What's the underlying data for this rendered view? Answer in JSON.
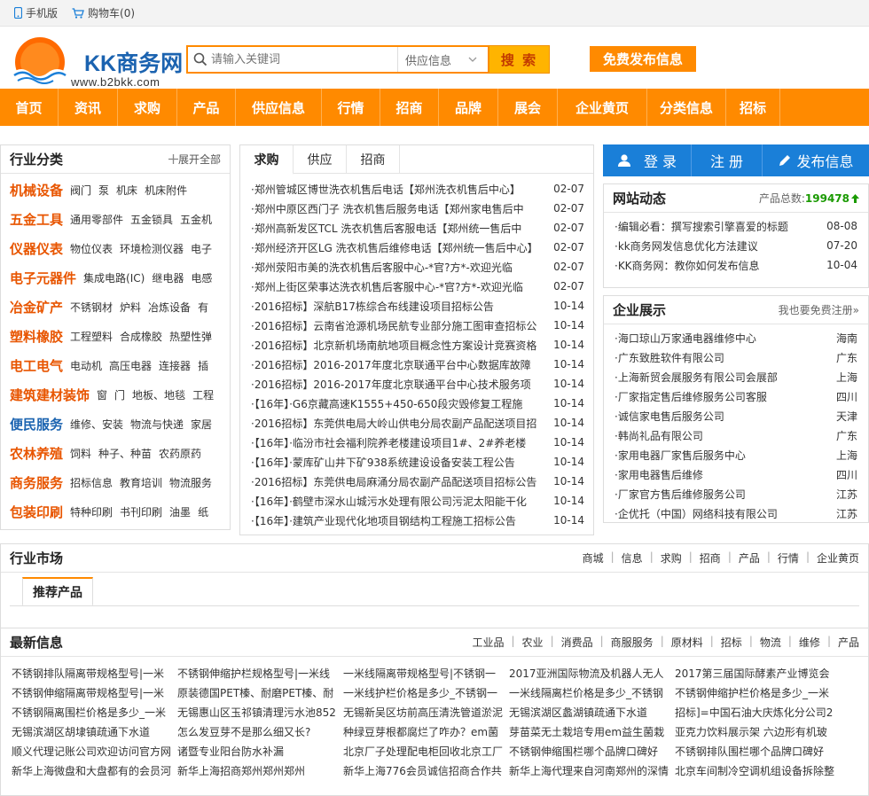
{
  "topbar": {
    "mobile": "手机版",
    "cart": "购物车(0)"
  },
  "logo": {
    "name": "KK商务网",
    "url": "www.b2bkk.com"
  },
  "search": {
    "placeholder": "请输入关键词",
    "scope": "供应信息",
    "button": "搜 索"
  },
  "publish_button": "免费发布信息",
  "nav": [
    "首页",
    "资讯",
    "求购",
    "产品",
    "供应信息",
    "行情",
    "招商",
    "品牌",
    "展会",
    "企业黄页",
    "分类信息",
    "招标"
  ],
  "categories": {
    "title": "行业分类",
    "more": "展开全部",
    "rows": [
      {
        "name": "机械设备",
        "color": "#e85500",
        "subs": [
          "阀门",
          "泵",
          "机床",
          "机床附件"
        ]
      },
      {
        "name": "五金工具",
        "color": "#e85500",
        "subs": [
          "通用零部件",
          "五金锁具",
          "五金机"
        ]
      },
      {
        "name": "仪器仪表",
        "color": "#e85500",
        "subs": [
          "物位仪表",
          "环境检测仪器",
          "电子"
        ]
      },
      {
        "name": "电子元器件",
        "color": "#e85500",
        "subs": [
          "集成电路(IC)",
          "继电器",
          "电感"
        ]
      },
      {
        "name": "冶金矿产",
        "color": "#e85500",
        "subs": [
          "不锈钢材",
          "炉料",
          "冶炼设备",
          "有"
        ]
      },
      {
        "name": "塑料橡胶",
        "color": "#e85500",
        "subs": [
          "工程塑料",
          "合成橡胶",
          "热塑性弹"
        ]
      },
      {
        "name": "电工电气",
        "color": "#e85500",
        "subs": [
          "电动机",
          "高压电器",
          "连接器",
          "插"
        ]
      },
      {
        "name": "建筑建材装饰",
        "color": "#e85500",
        "subs": [
          "窗",
          "门",
          "地板、地毯",
          "工程"
        ]
      },
      {
        "name": "便民服务",
        "color": "#1b63b0",
        "subs": [
          "维修、安装",
          "物流与快递",
          "家居"
        ]
      },
      {
        "name": "农林养殖",
        "color": "#e85500",
        "subs": [
          "饲料",
          "种子、种苗",
          "农药原药"
        ]
      },
      {
        "name": "商务服务",
        "color": "#e85500",
        "subs": [
          "招标信息",
          "教育培训",
          "物流服务"
        ]
      },
      {
        "name": "包装印刷",
        "color": "#e85500",
        "subs": [
          "特种印刷",
          "书刊印刷",
          "油墨",
          "纸"
        ]
      }
    ]
  },
  "tabs": [
    "求购",
    "供应",
    "招商"
  ],
  "news": [
    {
      "t": "·郑州管城区博世洗衣机售后电话【郑州洗衣机售后中心】",
      "d": "02-07"
    },
    {
      "t": "·郑州中原区西门子 洗衣机售后服务电话【郑州家电售后中",
      "d": "02-07"
    },
    {
      "t": "·郑州高新发区TCL 洗衣机售后客服电话【郑州统一售后中",
      "d": "02-07"
    },
    {
      "t": "·郑州经济开区LG 洗衣机售后维修电话【郑州统一售后中心】",
      "d": "02-07"
    },
    {
      "t": "·郑州荥阳市美的洗衣机售后客服中心-*官?方*-欢迎光临",
      "d": "02-07"
    },
    {
      "t": "·郑州上街区荣事达洗衣机售后客服中心-*官?方*-欢迎光临",
      "d": "02-07"
    },
    {
      "t": "·2016招标】深航B17栋综合布线建设项目招标公告",
      "d": "10-14"
    },
    {
      "t": "·2016招标】云南省沧源机场民航专业部分施工图审查招标公",
      "d": "10-14"
    },
    {
      "t": "·2016招标】北京新机场南航地项目概念性方案设计竞赛资格",
      "d": "10-14"
    },
    {
      "t": "·2016招标】2016-2017年度北京联通平台中心数据库故障",
      "d": "10-14"
    },
    {
      "t": "·2016招标】2016-2017年度北京联通平台中心技术服务项",
      "d": "10-14"
    },
    {
      "t": "·【16年】·G6京藏高速K1555+450-650段灾毁修复工程施",
      "d": "10-14"
    },
    {
      "t": "·2016招标】东莞供电局大岭山供电分局农副产品配送项目招",
      "d": "10-14"
    },
    {
      "t": "·【16年】·临汾市社会福利院养老楼建设项目1#、2#养老楼",
      "d": "10-14"
    },
    {
      "t": "·【16年】·蒙库矿山井下矿938系统建设设备安装工程公告",
      "d": "10-14"
    },
    {
      "t": "·2016招标】东莞供电局麻涌分局农副产品配送项目招标公告",
      "d": "10-14"
    },
    {
      "t": "·【16年】·鹤壁市深水山城污水处理有限公司污泥太阳能干化",
      "d": "10-14"
    },
    {
      "t": "·【16年】·建筑产业现代化地项目钢结构工程施工招标公告",
      "d": "10-14"
    }
  ],
  "auth": {
    "login": "登 录",
    "register": "注 册",
    "publish": "发布信息"
  },
  "dynamics": {
    "title": "网站动态",
    "total_label": "产品总数:",
    "total": "199478",
    "items": [
      {
        "t": "·编辑必看：撰写搜索引擎喜爱的标题",
        "d": "08-08"
      },
      {
        "t": "·kk商务网发信息优化方法建议",
        "d": "07-20"
      },
      {
        "t": "·KK商务网：教你如何发布信息",
        "d": "10-04"
      }
    ]
  },
  "enterprises": {
    "title": "企业展示",
    "more": "我也要免费注册»",
    "items": [
      {
        "n": "·海口琼山万家通电器维修中心",
        "c": "海南"
      },
      {
        "n": "·广东致胜软件有限公司",
        "c": "广东"
      },
      {
        "n": "·上海新贸会展服务有限公司会展部",
        "c": "上海"
      },
      {
        "n": "·厂家指定售后维修服务公司客服",
        "c": "四川"
      },
      {
        "n": "·诚信家电售后服务公司",
        "c": "天津"
      },
      {
        "n": "·韩尚礼品有限公司",
        "c": "广东"
      },
      {
        "n": "·家用电器厂家售后服务中心",
        "c": "上海"
      },
      {
        "n": "·家用电器售后维修",
        "c": "四川"
      },
      {
        "n": "·厂家官方售后维修服务公司",
        "c": "江苏"
      },
      {
        "n": "·企优托（中国）网络科技有限公司",
        "c": "江苏"
      }
    ]
  },
  "market": {
    "title": "行业市场",
    "links": [
      "商城",
      "|",
      "信息",
      "|",
      "求购",
      "|",
      "招商",
      "|",
      "产品",
      "|",
      "行情",
      "|",
      "企业黄页"
    ],
    "subtab": "推荐产品"
  },
  "latest": {
    "title": "最新信息",
    "links": [
      "工业品",
      "|",
      "农业",
      "|",
      "消费品",
      "|",
      "商服服务",
      "|",
      "原材料",
      "|",
      "招标",
      "|",
      "物流",
      "|",
      "维修",
      "|",
      "产品"
    ],
    "items": [
      "不锈钢排队隔离带规格型号|一米",
      "不锈钢伸缩护栏规格型号|一米线",
      "一米线隔离带规格型号|不锈钢一",
      "2017亚洲国际物流及机器人无人",
      "2017第三届国际酵素产业博览会",
      "不锈钢伸缩隔离带规格型号|一米",
      "原装德国PET榛、耐磨PET榛、耐",
      "一米线护栏价格是多少_不锈钢一",
      "一米线隔离栏价格是多少_不锈钢",
      "不锈钢伸缩护栏价格是多少_一米",
      "不锈钢隔离围栏价格是多少_一米",
      "无锡惠山区玉祁镇清理污水池852",
      "无锡新吴区坊前高压清洗管道淤泥",
      "无锡滨湖区蠡湖镇疏通下水道",
      "招标]=中国石油大庆炼化分公司2",
      "无锡滨湖区胡埭镇疏通下水道",
      "怎么发豆芽不是那么细又长?",
      "种绿豆芽根都腐烂了咋办？em菌",
      "芽苗菜无土栽培专用em益生菌栽",
      "亚克力饮料展示架 六边形有机玻",
      "顺义代理记账公司欢迎访问官方网",
      "诸暨专业阳台防水补漏",
      "北京厂子处理配电柜回收北京工厂",
      "不锈钢伸缩围栏哪个品牌口碑好",
      "不锈钢排队围栏哪个品牌口碑好",
      "新华上海微盘和大盘都有的会员河",
      "新华上海招商郑州郑州郑州",
      "新华上海776会员诚信招商合作共",
      "新华上海代理来自河南郑州的深情",
      "北京车间制冷空调机组设备拆除整"
    ]
  },
  "colors": {
    "accent": "#ff8a00",
    "brand_blue": "#1b63b0",
    "login_blue": "#1a7fd8",
    "category_orange": "#e85500",
    "total_green": "#1a9a00"
  }
}
